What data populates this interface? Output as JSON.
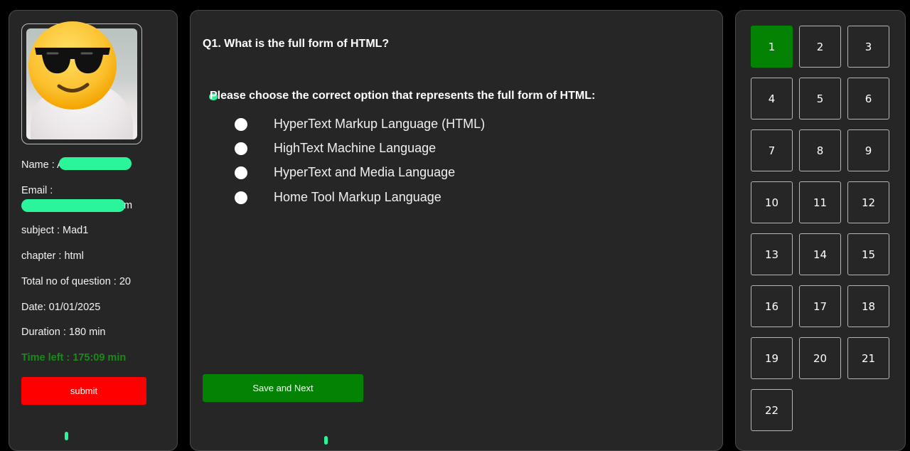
{
  "profile": {
    "name_label": "Name : A",
    "email_label": "Email :",
    "email_tail": "m",
    "subject": "subject : Mad1",
    "chapter": "chapter : html",
    "total_questions": "Total no of question : 20",
    "date": "Date: 01/01/2025",
    "duration": "Duration : 180 min",
    "time_left": "Time left : 175:09 min",
    "submit_label": "submit"
  },
  "question": {
    "title": "Q1. What is the full form of HTML?",
    "instruction": "Please choose the correct option that represents the full form of HTML:",
    "options": [
      "HyperText Markup Language (HTML)",
      "HighText Machine Language",
      "HyperText and Media Language",
      "Home Tool Markup Language"
    ],
    "save_label": "Save and Next"
  },
  "navigator": {
    "current": 1,
    "numbers": [
      "1",
      "2",
      "3",
      "4",
      "5",
      "6",
      "7",
      "8",
      "9",
      "10",
      "11",
      "12",
      "13",
      "14",
      "15",
      "16",
      "17",
      "18",
      "19",
      "20",
      "21",
      "22"
    ]
  },
  "colors": {
    "panel_bg": "#262626",
    "accent_green": "#038203",
    "submit_red": "#fe0000",
    "time_left_green": "#1a8a1a",
    "redaction": "#2bf59b"
  }
}
